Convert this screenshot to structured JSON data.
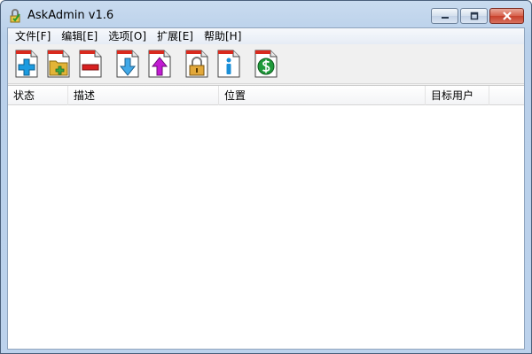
{
  "window": {
    "title": "AskAdmin v1.6",
    "caption_buttons": [
      "minimize",
      "restore",
      "close"
    ]
  },
  "menu": {
    "items": [
      {
        "label": "文件[F]"
      },
      {
        "label": "编辑[E]"
      },
      {
        "label": "选项[O]"
      },
      {
        "label": "扩展[E]"
      },
      {
        "label": "帮助[H]"
      }
    ]
  },
  "toolbar": {
    "buttons": [
      {
        "icon": "add-file-icon",
        "color": "#1a9be0"
      },
      {
        "icon": "add-folder-icon",
        "color": "#e3b437"
      },
      {
        "icon": "remove-icon",
        "color": "#d82020"
      },
      {
        "icon": "download-icon",
        "color": "#41a9e8"
      },
      {
        "icon": "upload-icon",
        "color": "#c21bd3"
      },
      {
        "icon": "lock-icon",
        "color": "#e2a83a"
      },
      {
        "icon": "info-icon",
        "color": "#1a8fd8"
      },
      {
        "icon": "dollar-icon",
        "color": "#1f9a3a"
      }
    ]
  },
  "list": {
    "columns": [
      {
        "label": "状态"
      },
      {
        "label": "描述"
      },
      {
        "label": "位置"
      },
      {
        "label": "目标用户"
      }
    ],
    "rows": []
  }
}
